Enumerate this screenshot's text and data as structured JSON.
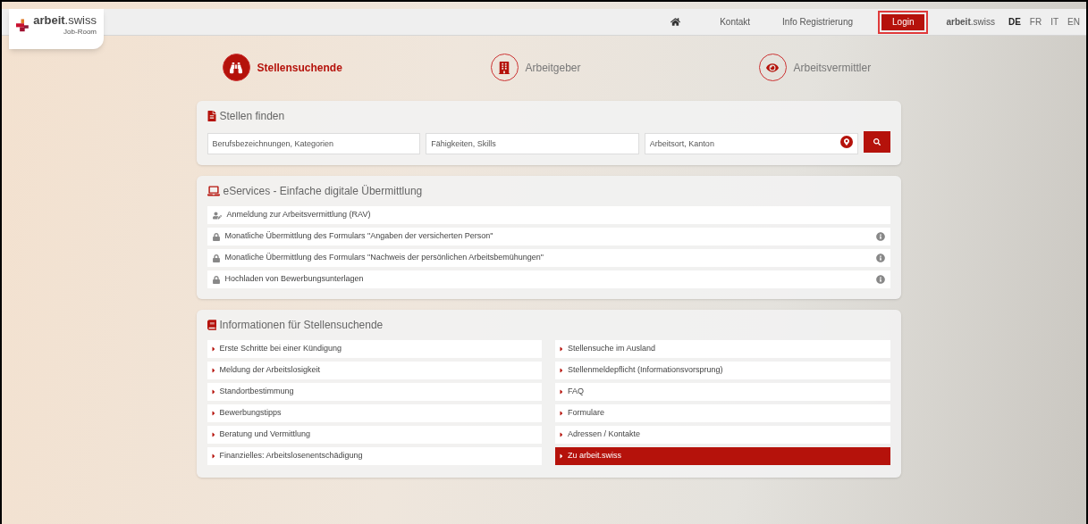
{
  "logo": {
    "name": "**arbeit**.swiss",
    "subtitle": "Job-Room"
  },
  "nav": {
    "links": [
      {
        "kind": "home"
      },
      {
        "kind": "link",
        "label": "Kontakt"
      },
      {
        "kind": "link",
        "label": "Info Registrierung"
      },
      {
        "kind": "button",
        "label": "Login"
      }
    ],
    "brand": "**arbeit**.swiss",
    "languages": [
      {
        "label": "DE",
        "selected": true
      },
      {
        "label": "FR",
        "selected": false
      },
      {
        "label": "IT",
        "selected": false
      },
      {
        "label": "EN",
        "selected": false
      }
    ]
  },
  "roles": [
    {
      "kind": "jobseeker",
      "label": "Stellensuchende",
      "selected": true
    },
    {
      "kind": "employer",
      "label": "Arbeitgeber",
      "selected": false
    },
    {
      "kind": "agency",
      "label": "Arbeitsvermittler",
      "selected": false
    }
  ],
  "search": {
    "title": "Stellen finden",
    "fields": [
      {
        "placeholder": "Berufsbezeichnungen, Kategorien"
      },
      {
        "placeholder": "Fähigkeiten, Skills"
      },
      {
        "placeholder": "Arbeitsort, Kanton"
      }
    ]
  },
  "eservices": {
    "title": "eServices - Einfache digitale Übermittlung",
    "items": [
      {
        "kind": "user",
        "label": "Anmeldung zur Arbeitsvermittlung (RAV)",
        "info": false
      },
      {
        "kind": "locked",
        "label": "Monatliche Übermittlung des Formulars \"Angaben der versicherten Person\"",
        "info": true
      },
      {
        "kind": "locked",
        "label": "Monatliche Übermittlung des Formulars \"Nachweis der persönlichen Arbeitsbemühungen\"",
        "info": true
      },
      {
        "kind": "locked",
        "label": "Hochladen von Bewerbungsunterlagen",
        "info": true
      }
    ]
  },
  "info": {
    "title": "Informationen für Stellensuchende",
    "links": [
      {
        "label": "Erste Schritte bei einer Kündigung",
        "selected": false
      },
      {
        "label": "Stellensuche im Ausland",
        "selected": false
      },
      {
        "label": "Meldung der Arbeitslosigkeit",
        "selected": false
      },
      {
        "label": "Stellenmeldepflicht (Informationsvorsprung)",
        "selected": false
      },
      {
        "label": "Standortbestimmung",
        "selected": false
      },
      {
        "label": "FAQ",
        "selected": false
      },
      {
        "label": "Bewerbungstipps",
        "selected": false
      },
      {
        "label": "Formulare",
        "selected": false
      },
      {
        "label": "Beratung und Vermittlung",
        "selected": false
      },
      {
        "label": "Adressen / Kontakte",
        "selected": false
      },
      {
        "label": "Finanzielles: Arbeitslosenentschädigung",
        "selected": false
      },
      {
        "label": "Zu arbeit.swiss",
        "selected": true
      }
    ]
  }
}
